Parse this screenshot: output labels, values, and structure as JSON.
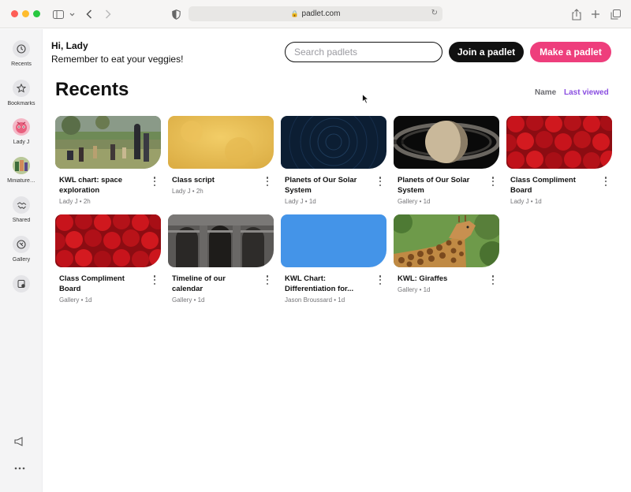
{
  "browser": {
    "url": "padlet.com"
  },
  "sidebar": {
    "items": [
      {
        "label": "Recents",
        "icon": "clock-icon"
      },
      {
        "label": "Bookmarks",
        "icon": "star-icon"
      },
      {
        "label": "Lady J",
        "icon": "avatar"
      },
      {
        "label": "Miniature…",
        "icon": "avatar"
      },
      {
        "label": "Shared",
        "icon": "handshake-icon"
      },
      {
        "label": "Gallery",
        "icon": "compass-icon"
      },
      {
        "label": "",
        "icon": "trash-icon"
      }
    ],
    "footer": [
      {
        "icon": "megaphone-icon"
      },
      {
        "icon": "more-icon"
      }
    ]
  },
  "header": {
    "greeting": "Hi, Lady",
    "message": "Remember to eat your veggies!",
    "search_placeholder": "Search padlets",
    "join_label": "Join a padlet",
    "make_label": "Make a padlet"
  },
  "main": {
    "title": "Recents",
    "sort": {
      "name_label": "Name",
      "last_viewed_label": "Last viewed",
      "active": "Last viewed"
    }
  },
  "cards": [
    {
      "title_line1": "KWL chart: space",
      "title_line2": "exploration",
      "meta": "Lady J • 2h",
      "thumb": "painting"
    },
    {
      "title_line1": "Class script",
      "title_line2": "",
      "meta": "Lady J • 2h",
      "thumb": "gold"
    },
    {
      "title_line1": "Planets of Our Solar",
      "title_line2": "System",
      "meta": "Lady J • 1d",
      "thumb": "starfield"
    },
    {
      "title_line1": "Planets of Our Solar",
      "title_line2": "System",
      "meta": "Gallery • 1d",
      "thumb": "saturn"
    },
    {
      "title_line1": "Class Compliment",
      "title_line2": "Board",
      "meta": "Lady J • 1d",
      "thumb": "roses"
    },
    {
      "title_line1": "Class Compliment",
      "title_line2": "Board",
      "meta": "Gallery • 1d",
      "thumb": "roses"
    },
    {
      "title_line1": "Timeline of our",
      "title_line2": "calendar",
      "meta": "Gallery • 1d",
      "thumb": "colosseum"
    },
    {
      "title_line1": "KWL Chart:",
      "title_line2": "Differentiation for...",
      "meta": "Jason Broussard • 1d",
      "thumb": "blue"
    },
    {
      "title_line1": "KWL: Giraffes",
      "title_line2": "",
      "meta": "Gallery • 1d",
      "thumb": "giraffe"
    }
  ],
  "colors": {
    "accent_pink": "#ee3e7c",
    "accent_purple": "#8a4ee0",
    "dark_button": "#111111",
    "blue_thumb": "#4494e8"
  }
}
